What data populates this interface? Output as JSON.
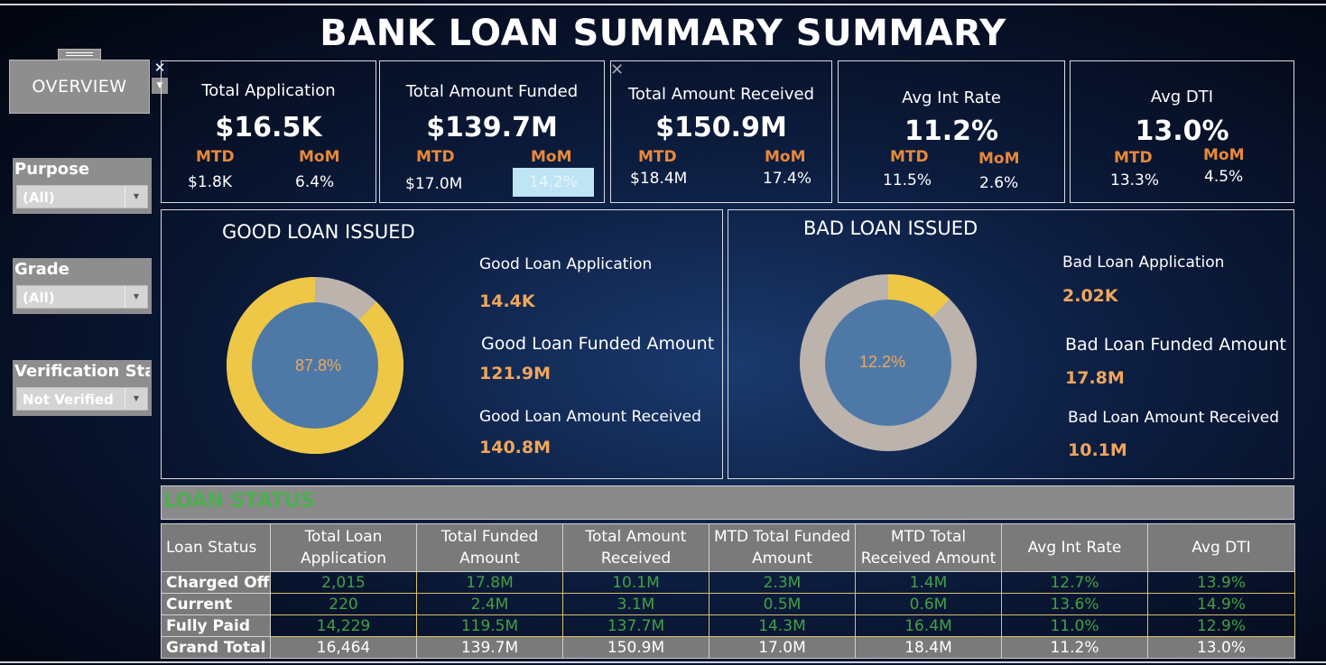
{
  "title": "BANK LOAN SUMMARY SUMMARY",
  "nav": {
    "label": "OVERVIEW",
    "close": "✕",
    "drop": "▼"
  },
  "filters": [
    {
      "label": "Purpose",
      "value": "(All)"
    },
    {
      "label": "Grade",
      "value": "(All)"
    },
    {
      "label": "Verification Stat..",
      "value": "Not Verified"
    }
  ],
  "kpis": [
    {
      "title": "Total Application",
      "value": "$16.5K",
      "mtd_label": "MTD",
      "mom_label": "MoM",
      "mtd": "$1.8K",
      "mom": "6.4%"
    },
    {
      "title": "Total Amount Funded",
      "value": "$139.7M",
      "mtd_label": "MTD",
      "mom_label": "MoM",
      "mtd": "$17.0M",
      "mom": "14.2%"
    },
    {
      "title": "Total Amount Received",
      "value": "$150.9M",
      "mtd_label": "MTD",
      "mom_label": "MoM",
      "mtd": "$18.4M",
      "mom": "17.4%"
    },
    {
      "title": "Avg Int Rate",
      "value": "11.2%",
      "mtd_label": "MTD",
      "mom_label": "MoM",
      "mtd": "11.5%",
      "mom": "2.6%"
    },
    {
      "title": "Avg DTI",
      "value": "13.0%",
      "mtd_label": "MTD",
      "mom_label": "MoM",
      "mtd": "13.3%",
      "mom": "4.5%"
    }
  ],
  "good": {
    "title": "GOOD LOAN ISSUED",
    "pct_label": "87.8%",
    "pct": 87.8,
    "app_label": "Good Loan Application",
    "app_value": "14.4K",
    "funded_label": "Good Loan Funded Amount",
    "funded_value": "121.9M",
    "received_label": "Good Loan Amount Received",
    "received_value": "140.8M"
  },
  "bad": {
    "title": "BAD LOAN ISSUED",
    "pct_label": "12.2%",
    "pct": 12.2,
    "app_label": "Bad Loan Application",
    "app_value": "2.02K",
    "funded_label": "Bad Loan Funded Amount",
    "funded_value": "17.8M",
    "received_label": "Bad Loan Amount Received",
    "received_value": "10.1M"
  },
  "colors": {
    "ring_yellow": "#edc745",
    "ring_gray": "#bcb3ad",
    "center_blue": "#4e79a7",
    "orange": "#f0a65c",
    "green": "#43a047"
  },
  "loan_status": {
    "title": "LOAN STATUS",
    "headers": [
      "Loan Status",
      "Total Loan Application",
      "Total Funded Amount",
      "Total Amount Received",
      "MTD Total Funded Amount",
      "MTD Total Received Amount",
      "Avg Int Rate",
      "Avg DTI"
    ],
    "rows": [
      [
        "Charged Off",
        "2,015",
        "17.8M",
        "10.1M",
        "2.3M",
        "1.4M",
        "12.7%",
        "13.9%"
      ],
      [
        "Current",
        "220",
        "2.4M",
        "3.1M",
        "0.5M",
        "0.6M",
        "13.6%",
        "14.9%"
      ],
      [
        "Fully Paid",
        "14,229",
        "119.5M",
        "137.7M",
        "14.3M",
        "16.4M",
        "11.0%",
        "12.9%"
      ]
    ],
    "total": [
      "Grand Total",
      "16,464",
      "139.7M",
      "150.9M",
      "17.0M",
      "18.4M",
      "11.2%",
      "13.0%"
    ]
  }
}
